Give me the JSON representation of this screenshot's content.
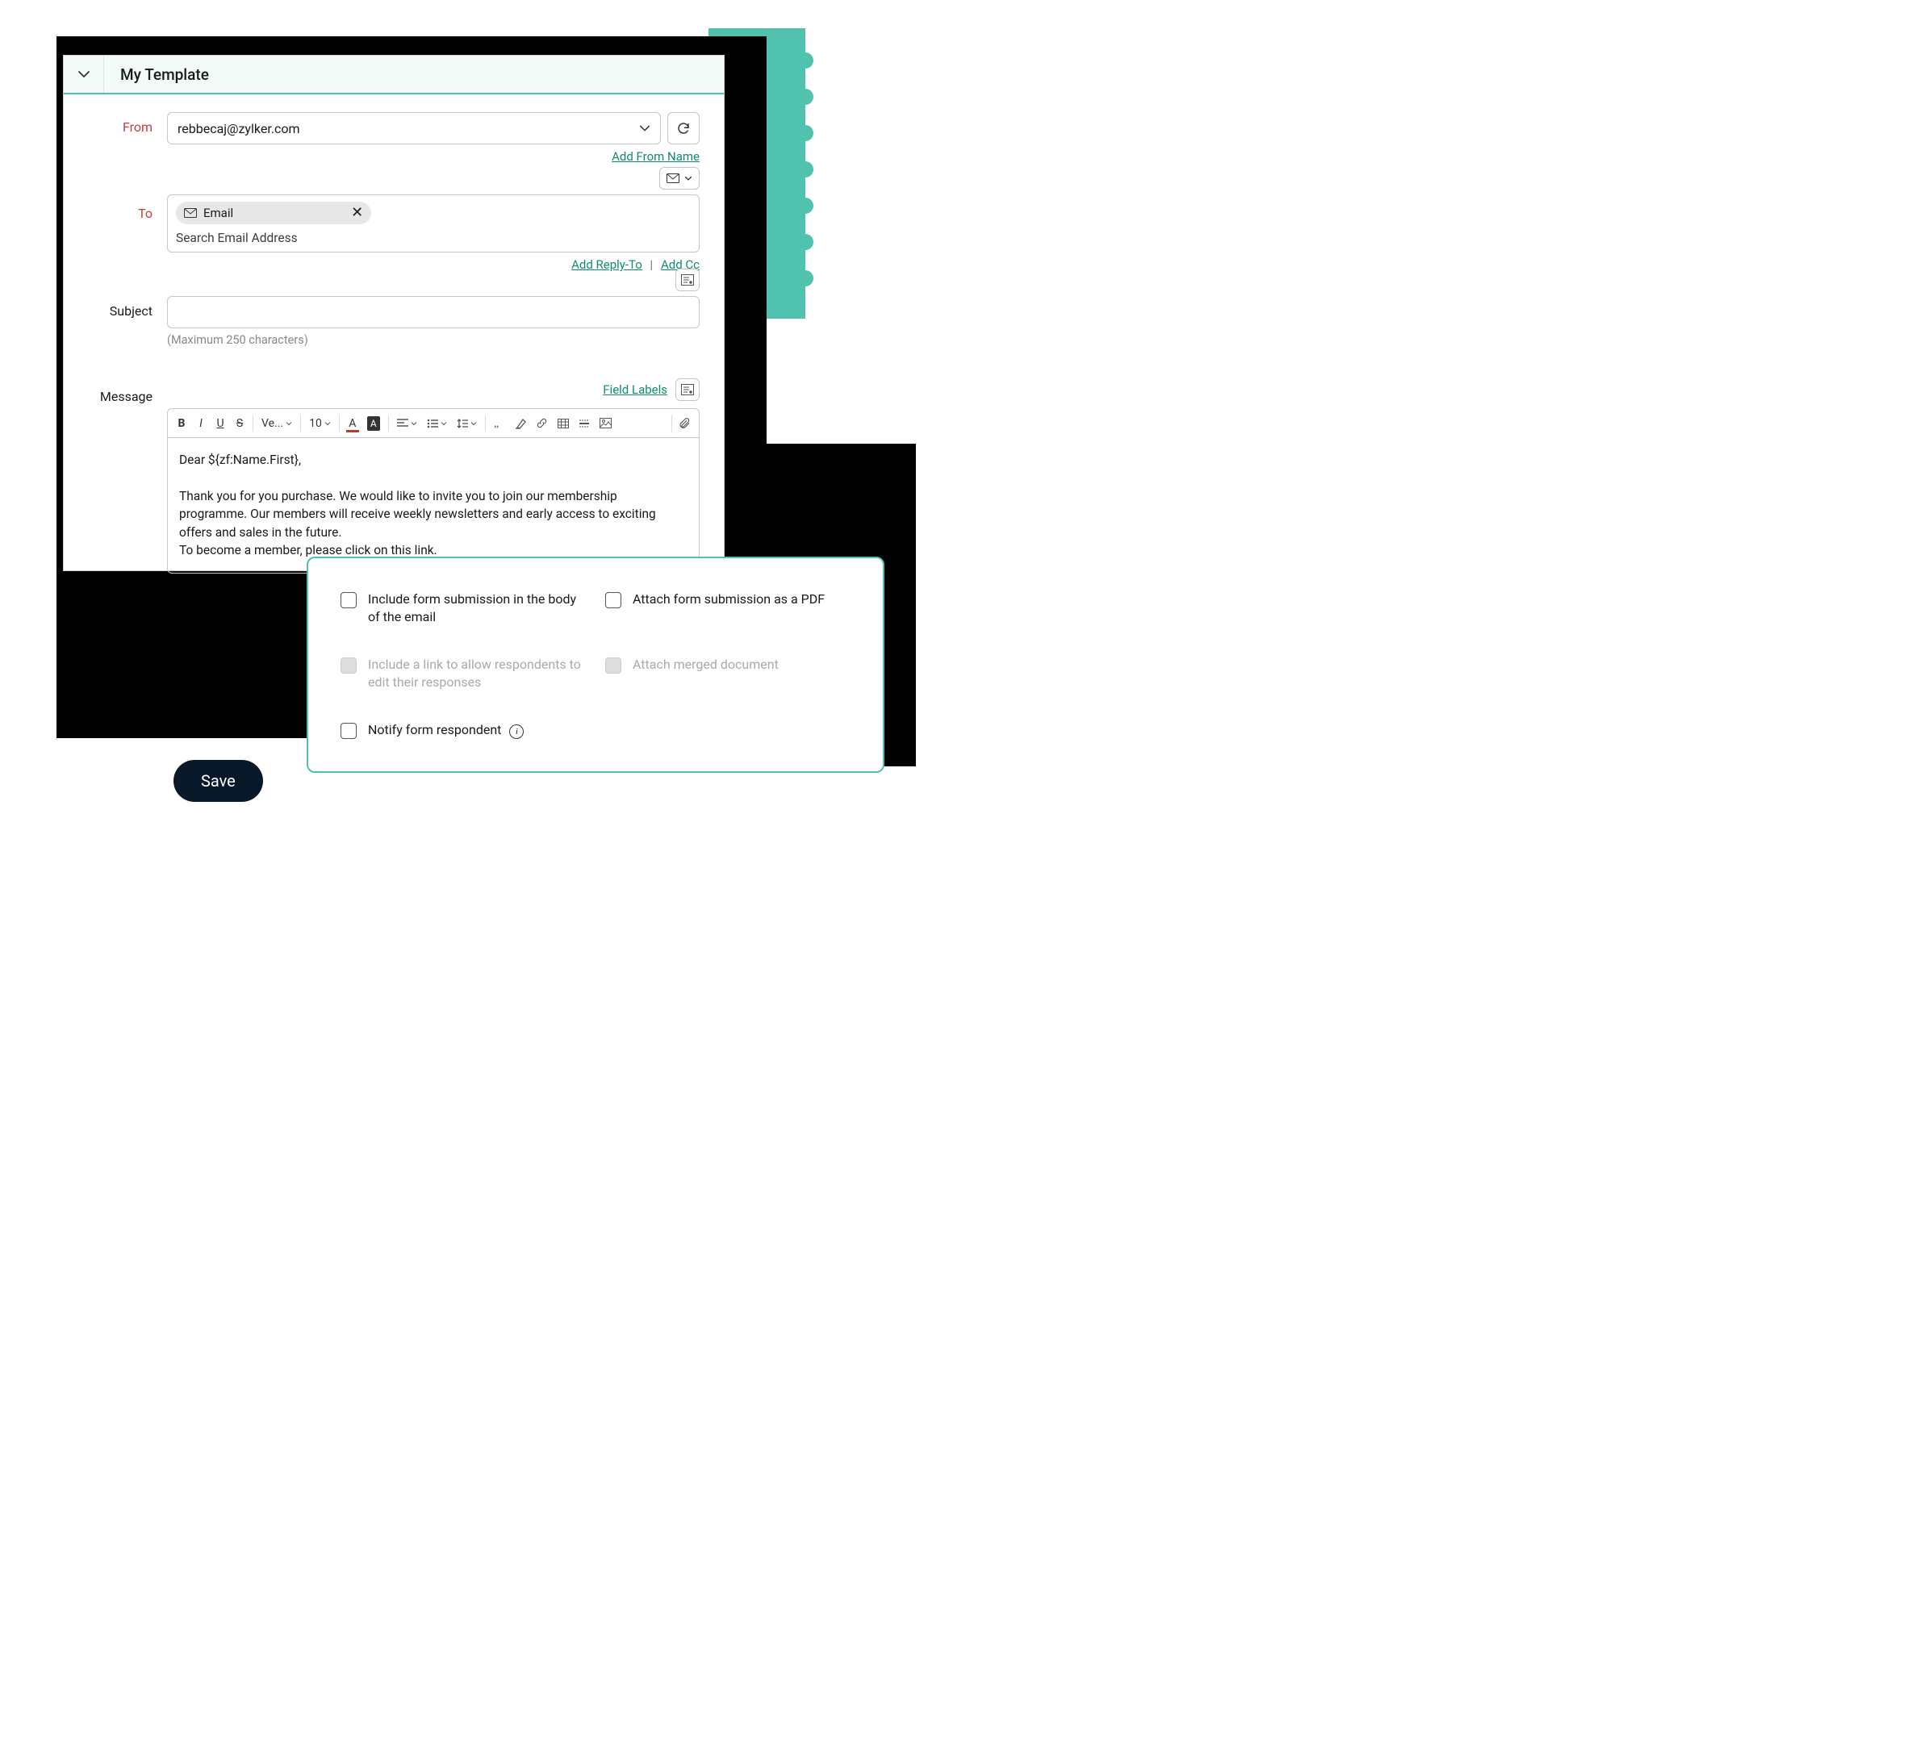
{
  "header": {
    "title": "My Template"
  },
  "from": {
    "label": "From",
    "value": "rebbecaj@zylker.com",
    "add_name_link": "Add From Name"
  },
  "to": {
    "label": "To",
    "chip_label": "Email",
    "placeholder": "Search Email Address",
    "add_replyto_link": "Add Reply-To",
    "add_cc_link": "Add Cc"
  },
  "subject": {
    "label": "Subject",
    "helper": "(Maximum 250 characters)"
  },
  "message": {
    "label": "Message",
    "field_labels_link": "Field Labels",
    "toolbar": {
      "font_family": "Ve...",
      "font_size": "10"
    },
    "body_line1": "Dear ${zf:Name.First},",
    "body_line2": "Thank you for you purchase. We would like to invite you to join our membership programme. Our members will receive weekly newsletters and early access to exciting offers and sales in the future.",
    "body_line3": "To become a member, please click on this link."
  },
  "options": {
    "opt1": "Include form submission in the body of the email",
    "opt2": "Attach form submission as a PDF",
    "opt3": "Include a link to allow respondents to edit their responses",
    "opt4": "Attach merged document",
    "opt5": "Notify form respondent"
  },
  "save_label": "Save"
}
